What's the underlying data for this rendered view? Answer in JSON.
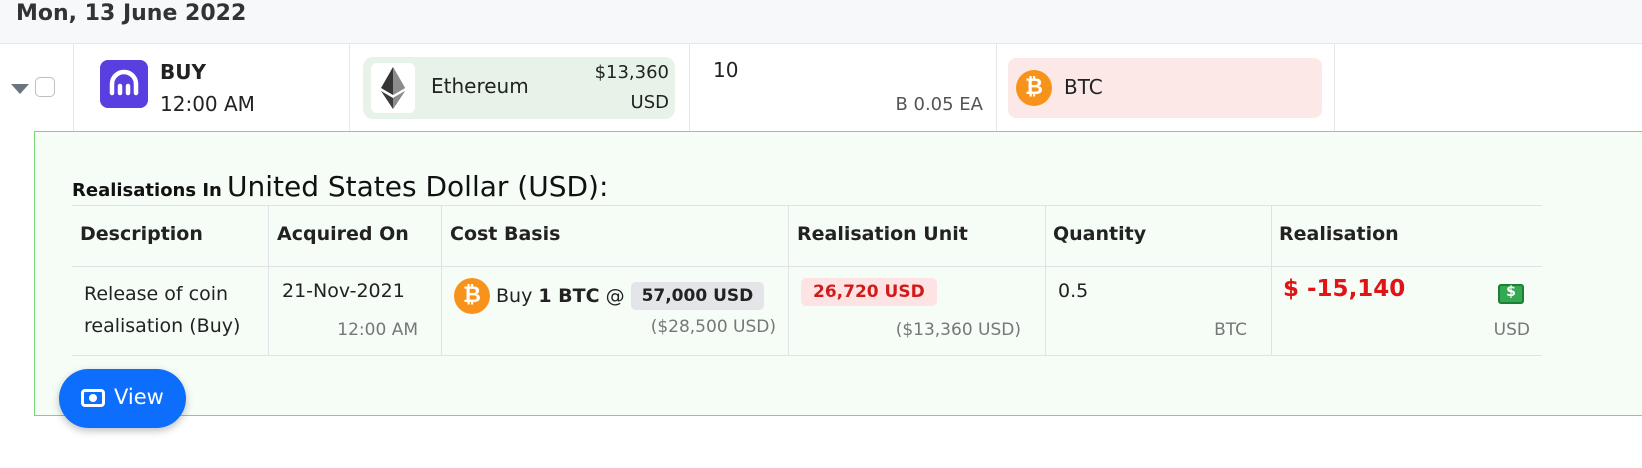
{
  "date_header": "Mon, 13 June 2022",
  "transaction": {
    "exchange_icon": "kraken-icon",
    "type": "BUY",
    "time": "12:00 AM",
    "sent": {
      "coin_icon": "ethereum-icon",
      "name": "Ethereum",
      "amount": "$13,360",
      "currency": "USD",
      "card_color": "#e7f3e8"
    },
    "quantity": "10",
    "rate": "B 0.05 EA",
    "received": {
      "coin_icon": "bitcoin-icon",
      "name": "BTC",
      "card_color": "#fde8e8"
    }
  },
  "details": {
    "heading_prefix": "Realisations In",
    "heading_currency": "United States Dollar (USD):",
    "columns": [
      "Description",
      "Acquired On",
      "Cost Basis",
      "Realisation Unit",
      "Quantity",
      "Realisation"
    ],
    "row": {
      "description_line1": "Release of coin",
      "description_line2": "realisation (Buy)",
      "acquired_date": "21-Nov-2021",
      "acquired_time": "12:00 AM",
      "cost_basis_prefix": "Buy",
      "cost_basis_amount": "1 BTC",
      "cost_basis_at": "@",
      "cost_basis_price": "57,000 USD",
      "cost_basis_total": "($28,500 USD)",
      "realisation_unit": "26,720 USD",
      "realisation_unit_usd": "($13,360 USD)",
      "quantity": "0.5",
      "quantity_unit": "BTC",
      "realisation_value": "$ -15,140",
      "realisation_currency": "USD",
      "realisation_icon": "cash-icon"
    }
  },
  "view_button": {
    "label": "View",
    "icon": "view-icon",
    "color": "#0d6efd"
  },
  "colors": {
    "accent": "#0d6efd",
    "negative": "#e01414",
    "details_border": "#7bd77b"
  }
}
